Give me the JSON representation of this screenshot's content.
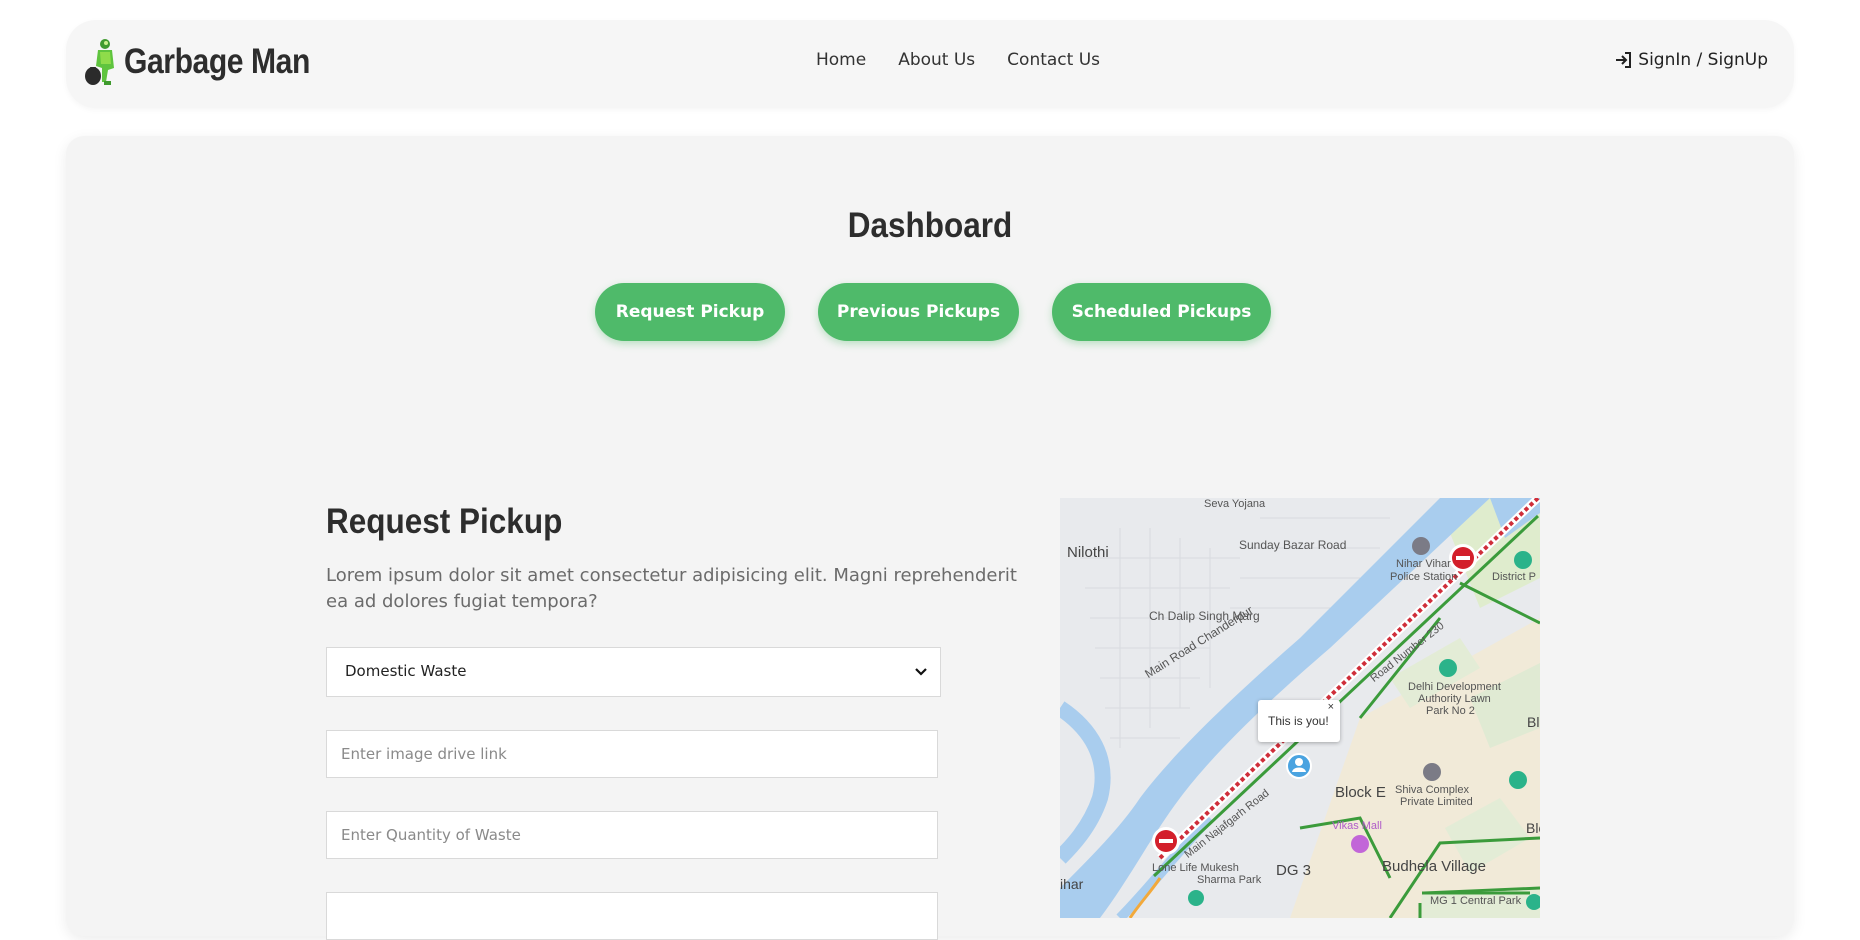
{
  "brand": {
    "name": "Garbage Man"
  },
  "nav": {
    "links": [
      "Home",
      "About Us",
      "Contact Us"
    ],
    "signin_label": "SignIn / SignUp"
  },
  "dashboard": {
    "title": "Dashboard",
    "buttons": [
      "Request Pickup",
      "Previous Pickups",
      "Scheduled Pickups"
    ]
  },
  "form": {
    "title": "Request Pickup",
    "description": "Lorem ipsum dolor sit amet consectetur adipisicing elit. Magni reprehenderit ea ad dolores fugiat tempora?",
    "waste_type": "Domestic Waste",
    "image_link_placeholder": "Enter image drive link",
    "quantity_placeholder": "Enter Quantity of Waste"
  },
  "map": {
    "popup_text": "This is you!",
    "popup_close": "×",
    "labels": [
      "Sunday Bazar Road",
      "Nilothi",
      "Ch Dalip Singh Marg",
      "Main Road Chanderpur",
      "Nihar Vihar",
      "Police Station",
      "District P",
      "Delhi Development",
      "Authority Lawn",
      "Park No 2",
      "Block E",
      "Shiva Complex",
      "Private Limited",
      "Vikas Mall",
      "DG 3",
      "Budhela Village",
      "Lone Life Mukesh",
      "Sharma Park",
      "MG 1 Central Park",
      "ihar",
      "Seva Yojana",
      "Bl",
      "Blo",
      "Road Number 230",
      "Main Najafgarh Road"
    ]
  },
  "colors": {
    "accent": "#4fba6a",
    "panel": "#f4f4f4",
    "navbar": "#f6f6f6"
  }
}
